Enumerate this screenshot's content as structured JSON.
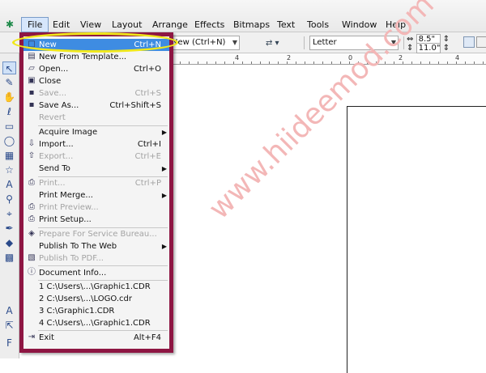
{
  "menubar": {
    "app_icon": "corel-icon",
    "items": [
      "File",
      "Edit",
      "View",
      "Layout",
      "Arrange",
      "Effects",
      "Bitmaps",
      "Text",
      "Tools",
      "Window",
      "Help"
    ]
  },
  "toolbar": {
    "tooltip": "New (Ctrl+N)",
    "paper": "Letter",
    "width": "8.5\"",
    "height": "11.0\""
  },
  "ruler": {
    "numbers": [
      "4",
      "2",
      "0",
      "2",
      "4"
    ]
  },
  "file_menu": {
    "items": [
      {
        "icon": "new-doc-icon",
        "glyph": "□",
        "label": "New",
        "shortcut": "Ctrl+N",
        "state": "highlight"
      },
      {
        "icon": "template-icon",
        "glyph": "▤",
        "label": "New From Template...",
        "shortcut": "",
        "state": ""
      },
      {
        "icon": "open-folder-icon",
        "glyph": "▱",
        "label": "Open...",
        "shortcut": "Ctrl+O",
        "state": ""
      },
      {
        "icon": "close-icon",
        "glyph": "▣",
        "label": "Close",
        "shortcut": "",
        "state": ""
      },
      {
        "icon": "save-icon",
        "glyph": "▪",
        "label": "Save...",
        "shortcut": "Ctrl+S",
        "state": "disabled"
      },
      {
        "icon": "save-as-icon",
        "glyph": "▪",
        "label": "Save As...",
        "shortcut": "Ctrl+Shift+S",
        "state": ""
      },
      {
        "icon": "",
        "glyph": "",
        "label": "Revert",
        "shortcut": "",
        "state": "disabled"
      },
      {
        "icon": "",
        "glyph": "",
        "label": "Acquire Image",
        "shortcut": "",
        "state": "submenu"
      },
      {
        "icon": "import-icon",
        "glyph": "⇩",
        "label": "Import...",
        "shortcut": "Ctrl+I",
        "state": ""
      },
      {
        "icon": "export-icon",
        "glyph": "⇧",
        "label": "Export...",
        "shortcut": "Ctrl+E",
        "state": "disabled"
      },
      {
        "icon": "",
        "glyph": "",
        "label": "Send To",
        "shortcut": "",
        "state": "submenu"
      },
      {
        "icon": "print-icon",
        "glyph": "⎙",
        "label": "Print...",
        "shortcut": "Ctrl+P",
        "state": "disabled"
      },
      {
        "icon": "",
        "glyph": "",
        "label": "Print Merge...",
        "shortcut": "",
        "state": "submenu"
      },
      {
        "icon": "print-preview-icon",
        "glyph": "⎙",
        "label": "Print Preview...",
        "shortcut": "",
        "state": "disabled"
      },
      {
        "icon": "print-setup-icon",
        "glyph": "⎙",
        "label": "Print Setup...",
        "shortcut": "",
        "state": ""
      },
      {
        "icon": "service-bureau-icon",
        "glyph": "◈",
        "label": "Prepare For Service Bureau...",
        "shortcut": "",
        "state": "disabled"
      },
      {
        "icon": "",
        "glyph": "",
        "label": "Publish To The Web",
        "shortcut": "",
        "state": "submenu"
      },
      {
        "icon": "pdf-icon",
        "glyph": "▧",
        "label": "Publish To PDF...",
        "shortcut": "",
        "state": "disabled"
      },
      {
        "icon": "info-icon",
        "glyph": "ⓘ",
        "label": "Document Info...",
        "shortcut": "",
        "state": ""
      },
      {
        "icon": "",
        "glyph": "",
        "label": "1 C:\\Users\\...\\Graphic1.CDR",
        "shortcut": "",
        "state": ""
      },
      {
        "icon": "",
        "glyph": "",
        "label": "2 C:\\Users\\...\\LOGO.cdr",
        "shortcut": "",
        "state": ""
      },
      {
        "icon": "",
        "glyph": "",
        "label": "3 C:\\Graphic1.CDR",
        "shortcut": "",
        "state": ""
      },
      {
        "icon": "",
        "glyph": "",
        "label": "4 C:\\Users\\...\\Graphic1.CDR",
        "shortcut": "",
        "state": ""
      },
      {
        "icon": "exit-icon",
        "glyph": "⇥",
        "label": "Exit",
        "shortcut": "Alt+F4",
        "state": ""
      }
    ]
  },
  "watermark": "www.hiideemod.com",
  "colors": {
    "menu_border": "#8e1643",
    "highlight": "#3e8ce2",
    "ellipse": "#f0e81b"
  }
}
